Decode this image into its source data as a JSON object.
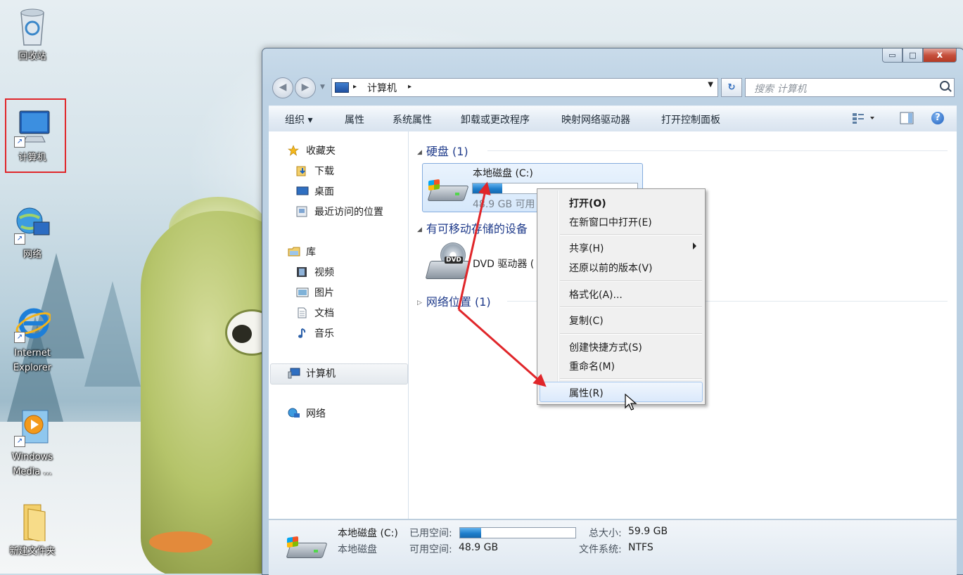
{
  "desktop": {
    "icons": [
      {
        "label": "回收站"
      },
      {
        "label": "计算机"
      },
      {
        "label": "网络"
      },
      {
        "label": "Internet Explorer"
      },
      {
        "label": "Windows Media ..."
      },
      {
        "label": "新建文件夹"
      }
    ]
  },
  "window": {
    "caption_buttons": {
      "minimize": "▭",
      "maximize": "□",
      "close": "x"
    },
    "address": {
      "crumb": "计算机",
      "separator": "▸"
    },
    "search": {
      "placeholder": "搜索 计算机"
    },
    "toolbar": {
      "organize": "组织 ▾",
      "properties": "属性",
      "system_properties": "系统属性",
      "uninstall": "卸载或更改程序",
      "map_drive": "映射网络驱动器",
      "control_panel": "打开控制面板",
      "help": "?"
    },
    "nav": {
      "favorites": "收藏夹",
      "downloads": "下载",
      "desktop": "桌面",
      "recent": "最近访问的位置",
      "libraries": "库",
      "videos": "视频",
      "pictures": "图片",
      "documents": "文档",
      "music": "音乐",
      "computer": "计算机",
      "network": "网络"
    },
    "groups": {
      "hard_disks": "硬盘 (1)",
      "removable": "有可移动存储的设备",
      "network_locations": "网络位置 (1)"
    },
    "drive_c": {
      "name": "本地磁盘 (C:)",
      "free_text": "48.9 GB 可用",
      "used_fraction": 0.18
    },
    "dvd": {
      "name": "DVD 驱动器 (",
      "badge": "DVD"
    },
    "statusbar": {
      "name": "本地磁盘 (C:)",
      "type": "本地磁盘",
      "used_label": "已用空间:",
      "free_label": "可用空间:",
      "free_value": "48.9 GB",
      "total_label": "总大小:",
      "total_value": "59.9 GB",
      "fs_label": "文件系统:",
      "fs_value": "NTFS",
      "used_fraction": 0.18
    }
  },
  "context_menu": {
    "items": [
      {
        "label": "打开(O)"
      },
      {
        "label": "在新窗口中打开(E)"
      },
      {
        "label": "共享(H)"
      },
      {
        "label": "还原以前的版本(V)"
      },
      {
        "label": "格式化(A)..."
      },
      {
        "label": "复制(C)"
      },
      {
        "label": "创建快捷方式(S)"
      },
      {
        "label": "重命名(M)"
      },
      {
        "label": "属性(R)"
      }
    ]
  },
  "colors": {
    "annotation_red": "#e0262a",
    "link_blue": "#1e3a8a",
    "menu_highlight": "#dbe9fb"
  }
}
